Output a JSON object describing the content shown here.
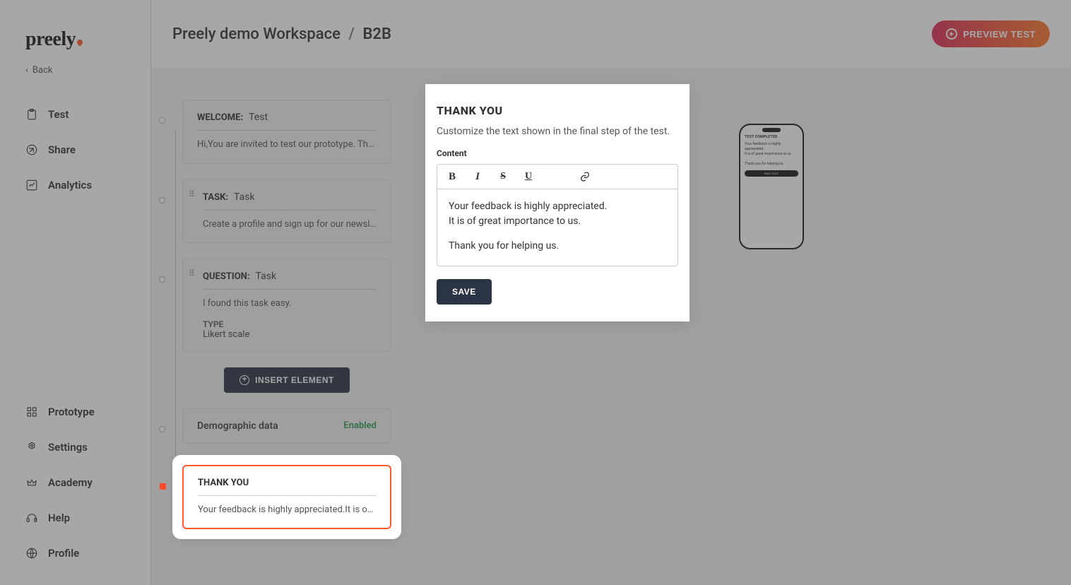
{
  "brand": "preely",
  "back_label": "Back",
  "nav": {
    "test": "Test",
    "share": "Share",
    "analytics": "Analytics",
    "prototype": "Prototype",
    "settings": "Settings",
    "academy": "Academy",
    "help": "Help",
    "profile": "Profile"
  },
  "breadcrumb": {
    "workspace": "Preely demo Workspace",
    "sep": "/",
    "current": "B2B"
  },
  "preview_label": "PREVIEW TEST",
  "steps": {
    "welcome": {
      "type": "WELCOME:",
      "title": "Test",
      "body": "Hi,You are invited to test our prototype. Thank …"
    },
    "task": {
      "type": "TASK:",
      "title": "Task",
      "body": "Create a profile and sign up for our newsletter."
    },
    "question": {
      "type": "QUESTION:",
      "title": "Task",
      "body": "I found this task easy.",
      "meta_label": "TYPE",
      "meta_value": "Likert scale"
    },
    "insert_label": "INSERT ELEMENT",
    "demographic": {
      "title": "Demographic data",
      "status": "Enabled"
    },
    "thankyou": {
      "type": "THANK YOU",
      "body": "Your feedback is highly appreciated.It is of gre…"
    }
  },
  "editor": {
    "title": "THANK YOU",
    "description": "Customize the text shown in the final step of the test.",
    "content_label": "Content",
    "content_line1": "Your feedback is highly appreciated.",
    "content_line2": "It is of great importance to us.",
    "content_line3": "Thank you for helping us.",
    "save_label": "SAVE",
    "toolbar": {
      "bold": "B",
      "italic": "I",
      "strike": "S",
      "under": "U"
    }
  },
  "phone": {
    "title": "TEST COMPLETED",
    "line1": "Your feedback is highly appreciated.",
    "line2": "It is of great importance to us.",
    "line3": "Thank you for helping us.",
    "button": "END TEST"
  }
}
